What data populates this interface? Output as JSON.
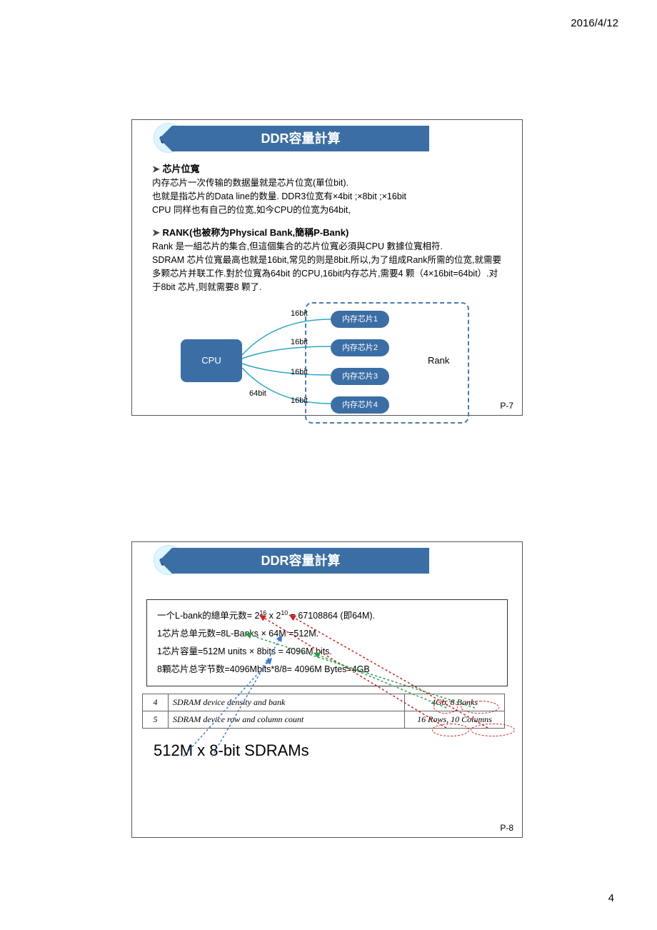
{
  "date": "2016/4/12",
  "page_number": "4",
  "slide1": {
    "title": "DDR容量計算",
    "heading1": "芯片位寬",
    "text1": "内存芯片一次传输的数据量就是芯片位宽(單位bit).\n也就是指芯片的Data line的数量. DDR3位宽有×4bit ;×8bit ;×16bit\nCPU 同样也有自己的位宽,如今CPU的位宽为64bit,",
    "heading2": "RANK(也被称为Physical Bank,簡稱P-Bank)",
    "text2": "Rank 是一組芯片的集合,但這個集合的芯片位寬必須與CPU 數據位寬相符.\n SDRAM 芯片位寬最高也就是16bit,常见的则是8bit.所以,为了组成Rank所需的位宽,就需要多颗芯片并联工作.對於位寬為64bit 的CPU,16bit内存芯片,需要4 颗（4×16bit=64bit）.对于8bit 芯片,则就需要8 颗了.",
    "diagram": {
      "cpu": "CPU",
      "bus": "64bit",
      "link": "16bit",
      "chips": [
        "内存芯片1",
        "内存芯片2",
        "内存芯片3",
        "内存芯片4"
      ],
      "rank": "Rank"
    },
    "pnum": "P-7"
  },
  "slide2": {
    "title": "DDR容量計算",
    "calc": {
      "line1_pre": "一个L-bank的總单元数= 2",
      "line1_exp1": "16",
      "line1_mid": " x 2",
      "line1_exp2": "10",
      "line1_post": " = 67108864 (即64M).",
      "line2": "1芯片总单元数=8L-Banks × 64M =512M.",
      "line3": "1芯片容量=512M units × 8bits = 4096M bits.",
      "line4": "8顆芯片总字节数=4096Mbits*8/8= 4096M Bytes=4GB"
    },
    "table": {
      "row1": {
        "n": "4",
        "desc": "SDRAM device density and bank",
        "val": "4Gb, 8 Banks"
      },
      "row2": {
        "n": "5",
        "desc": "SDRAM device row and column count",
        "val": "16 Rows, 10 Columns"
      }
    },
    "bigtext": "512M x 8-bit SDRAMs",
    "pnum": "P-8"
  }
}
